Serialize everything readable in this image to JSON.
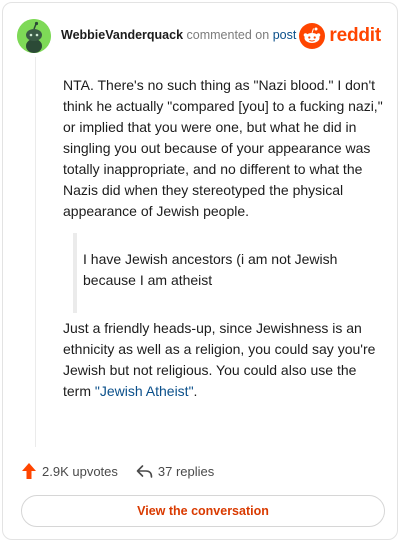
{
  "header": {
    "author": "WebbieVanderquack",
    "verb": "commented on",
    "post_link": "post",
    "brand": "reddit"
  },
  "comment": {
    "para1": "NTA. There's no such thing as \"Nazi blood.\" I don't think he actually \"compared [you] to a fucking nazi,\" or implied that you were one, but what he did in singling you out because of your appearance was totally inappropriate, and no different to what the Nazis did when they stereotyped the physical appearance of Jewish people.",
    "quote": "I have Jewish ancestors (i am not Jewish because I am atheist",
    "para3_before": "Just a friendly heads-up, since Jewishness is an ethnicity as well as a religion, you could say you're Jewish but not religious. You could also use the term ",
    "para3_link": "\"Jewish Atheist\"",
    "para3_after": "."
  },
  "footer": {
    "upvotes": "2.9K upvotes",
    "replies": "37 replies",
    "cta": "View the conversation"
  },
  "colors": {
    "accent": "#ff4500",
    "link": "#0a4f8a",
    "avatar": "#7ed957"
  }
}
